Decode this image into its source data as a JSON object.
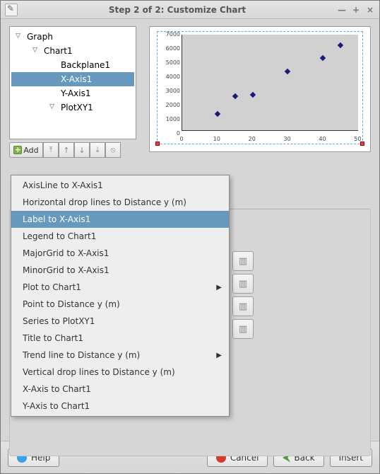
{
  "window": {
    "title": "Step 2 of 2: Customize Chart"
  },
  "tree": {
    "items": [
      {
        "label": "Graph",
        "indent": 1,
        "twisty": "▽",
        "selected": false
      },
      {
        "label": "Chart1",
        "indent": 2,
        "twisty": "▽",
        "selected": false
      },
      {
        "label": "Backplane1",
        "indent": 3,
        "twisty": "",
        "selected": false
      },
      {
        "label": "X-Axis1",
        "indent": 3,
        "twisty": "",
        "selected": true
      },
      {
        "label": "Y-Axis1",
        "indent": 3,
        "twisty": "",
        "selected": false
      },
      {
        "label": "PlotXY1",
        "indent": 3,
        "twisty": "▽",
        "selected": false
      }
    ]
  },
  "toolbar": {
    "add_label": "Add"
  },
  "menu": {
    "items": [
      {
        "label": "AxisLine to X-Axis1",
        "submenu": false,
        "selected": false
      },
      {
        "label": "Horizontal drop lines to Distance y (m)",
        "submenu": false,
        "selected": false
      },
      {
        "label": "Label to X-Axis1",
        "submenu": false,
        "selected": true
      },
      {
        "label": "Legend to Chart1",
        "submenu": false,
        "selected": false
      },
      {
        "label": "MajorGrid to X-Axis1",
        "submenu": false,
        "selected": false
      },
      {
        "label": "MinorGrid to X-Axis1",
        "submenu": false,
        "selected": false
      },
      {
        "label": "Plot to Chart1",
        "submenu": true,
        "selected": false
      },
      {
        "label": "Point to Distance y (m)",
        "submenu": false,
        "selected": false
      },
      {
        "label": "Series to PlotXY1",
        "submenu": false,
        "selected": false
      },
      {
        "label": "Title to Chart1",
        "submenu": false,
        "selected": false
      },
      {
        "label": "Trend line to Distance y (m)",
        "submenu": true,
        "selected": false
      },
      {
        "label": "Vertical drop lines to Distance y (m)",
        "submenu": false,
        "selected": false
      },
      {
        "label": "X-Axis to Chart1",
        "submenu": false,
        "selected": false
      },
      {
        "label": "Y-Axis to Chart1",
        "submenu": false,
        "selected": false
      }
    ]
  },
  "buttons": {
    "help": "Help",
    "cancel": "Cancel",
    "back": "Back",
    "insert": "Insert"
  },
  "chart_data": {
    "type": "scatter",
    "x": [
      10,
      15,
      20,
      30,
      40,
      45
    ],
    "y": [
      1200,
      2500,
      2600,
      4300,
      5300,
      6200
    ],
    "xlabel": "",
    "ylabel": "",
    "xlim": [
      0,
      50
    ],
    "ylim": [
      0,
      7000
    ],
    "xticks": [
      0,
      10,
      20,
      30,
      40,
      50
    ],
    "yticks": [
      0,
      1000,
      2000,
      3000,
      4000,
      5000,
      6000,
      7000
    ]
  }
}
